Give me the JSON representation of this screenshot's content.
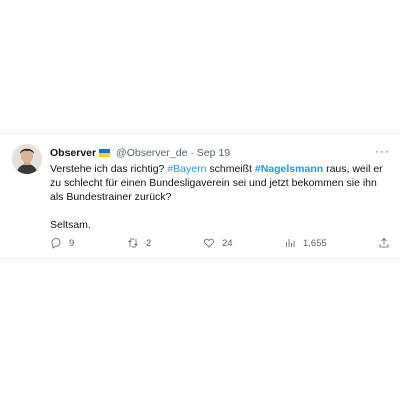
{
  "tweet": {
    "name": "Observer",
    "handle": "@Observer_de",
    "separator": "·",
    "date": "Sep 19",
    "more_label": "···",
    "text": {
      "t1": "Verstehe ich das richtig? ",
      "hash1": "#Bayern",
      "t2": " schmeißt ",
      "hash2": "#Nagelsmann",
      "t3": " raus, weil er zu schlecht für einen Bundesligaverein sei und jetzt bekommen sie ihn als Bundestrainer zurück?",
      "t4": "Seltsam."
    },
    "actions": {
      "replies": "9",
      "retweets": "2",
      "likes": "24",
      "views": "1,655"
    }
  },
  "colors": {
    "link": "#1d9bf0",
    "secondary": "#536471",
    "flag_blue": "#1f6fd6",
    "flag_yellow": "#ffd500"
  }
}
